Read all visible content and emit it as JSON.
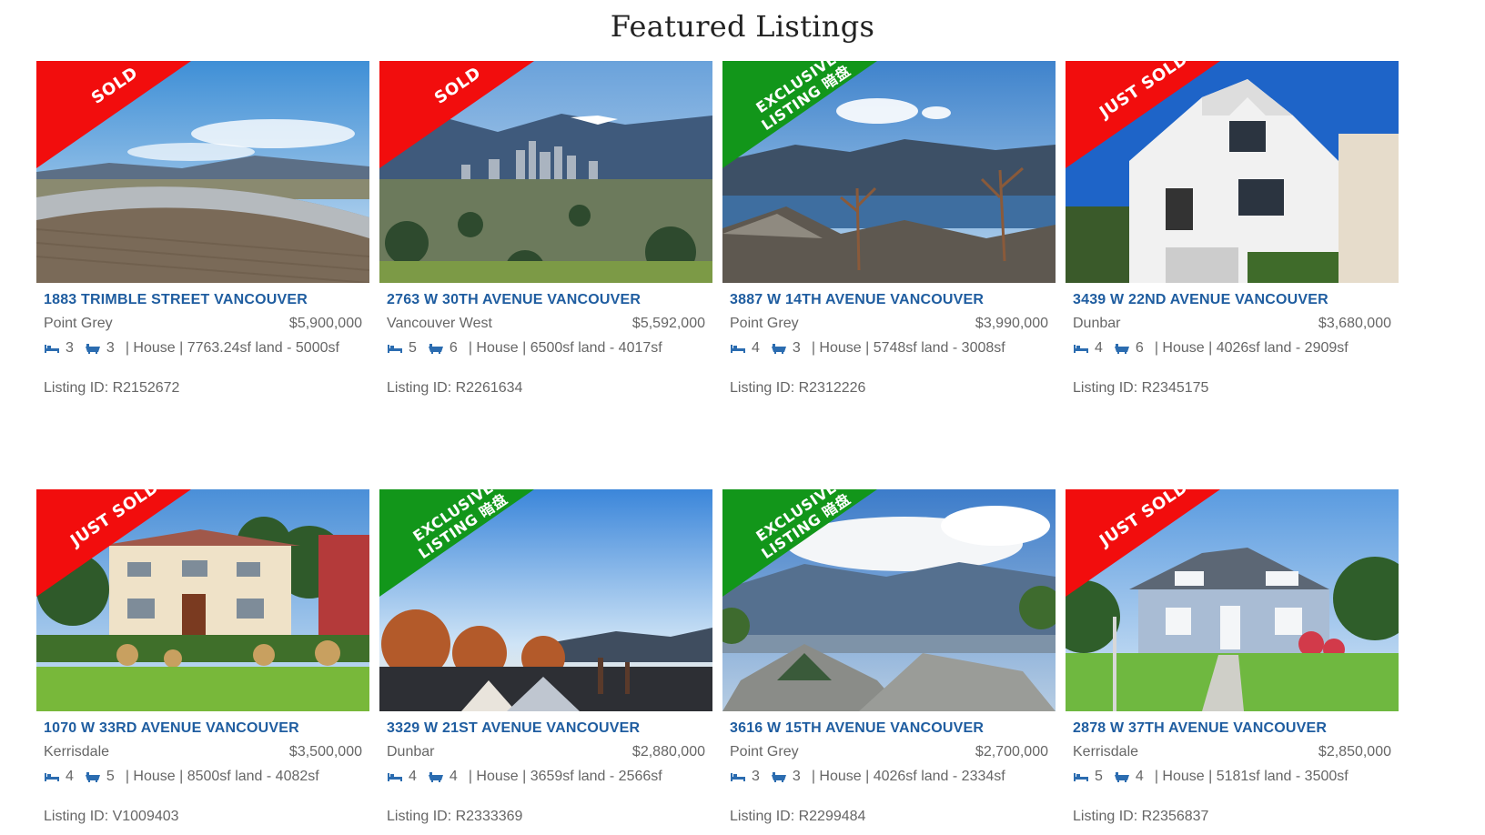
{
  "page": {
    "title": "Featured Listings"
  },
  "colors": {
    "sold": "#f20d0d",
    "exclusive": "#12961a",
    "link": "#1f5da0"
  },
  "listings": [
    {
      "badge": "SOLD",
      "badge_type": "sold",
      "address": "1883 TRIMBLE STREET VANCOUVER",
      "area": "Point Grey",
      "price": "$5,900,000",
      "beds": "3",
      "baths": "3",
      "details": "| House | 7763.24sf land - 5000sf",
      "listing_id": "Listing ID: R2152672",
      "scene": "deck"
    },
    {
      "badge": "SOLD",
      "badge_type": "sold",
      "address": "2763 W 30TH AVENUE VANCOUVER",
      "area": "Vancouver West",
      "price": "$5,592,000",
      "beds": "5",
      "baths": "6",
      "details": "| House | 6500sf land - 4017sf",
      "listing_id": "Listing ID: R2261634",
      "scene": "city"
    },
    {
      "badge": "EXCLUSIVE\nLISTING 暗盘",
      "badge_type": "exclusive",
      "address": "3887 W 14TH AVENUE VANCOUVER",
      "area": "Point Grey",
      "price": "$3,990,000",
      "beds": "4",
      "baths": "3",
      "details": "| House | 5748sf land - 3008sf",
      "listing_id": "Listing ID: R2312226",
      "scene": "bay"
    },
    {
      "badge": "JUST SOLD",
      "badge_type": "sold",
      "address": "3439 W 22ND AVENUE VANCOUVER",
      "area": "Dunbar",
      "price": "$3,680,000",
      "beds": "4",
      "baths": "6",
      "details": "| House | 4026sf land - 2909sf",
      "listing_id": "Listing ID: R2345175",
      "scene": "whitehouse"
    },
    {
      "badge": "JUST SOLD",
      "badge_type": "sold",
      "address": "1070 W 33RD AVENUE VANCOUVER",
      "area": "Kerrisdale",
      "price": "$3,500,000",
      "beds": "4",
      "baths": "5",
      "details": "| House | 8500sf land - 4082sf",
      "listing_id": "Listing ID: V1009403",
      "scene": "mansion"
    },
    {
      "badge": "EXCLUSIVE\nLISTING 暗盘",
      "badge_type": "exclusive",
      "address": "3329 W 21ST AVENUE VANCOUVER",
      "area": "Dunbar",
      "price": "$2,880,000",
      "beds": "4",
      "baths": "4",
      "details": "| House | 3659sf land - 2566sf",
      "listing_id": "Listing ID: R2333369",
      "scene": "sunset"
    },
    {
      "badge": "EXCLUSIVE\nLISTING 暗盘",
      "badge_type": "exclusive",
      "address": "3616 W 15TH AVENUE VANCOUVER",
      "area": "Point Grey",
      "price": "$2,700,000",
      "beds": "3",
      "baths": "3",
      "details": "| House | 4026sf land - 2334sf",
      "listing_id": "Listing ID: R2299484",
      "scene": "mountain"
    },
    {
      "badge": "JUST SOLD",
      "badge_type": "sold",
      "address": "2878 W 37TH AVENUE VANCOUVER",
      "area": "Kerrisdale",
      "price": "$2,850,000",
      "beds": "5",
      "baths": "4",
      "details": "| House | 5181sf land - 3500sf",
      "listing_id": "Listing ID: R2356837",
      "scene": "bluehouse"
    }
  ]
}
